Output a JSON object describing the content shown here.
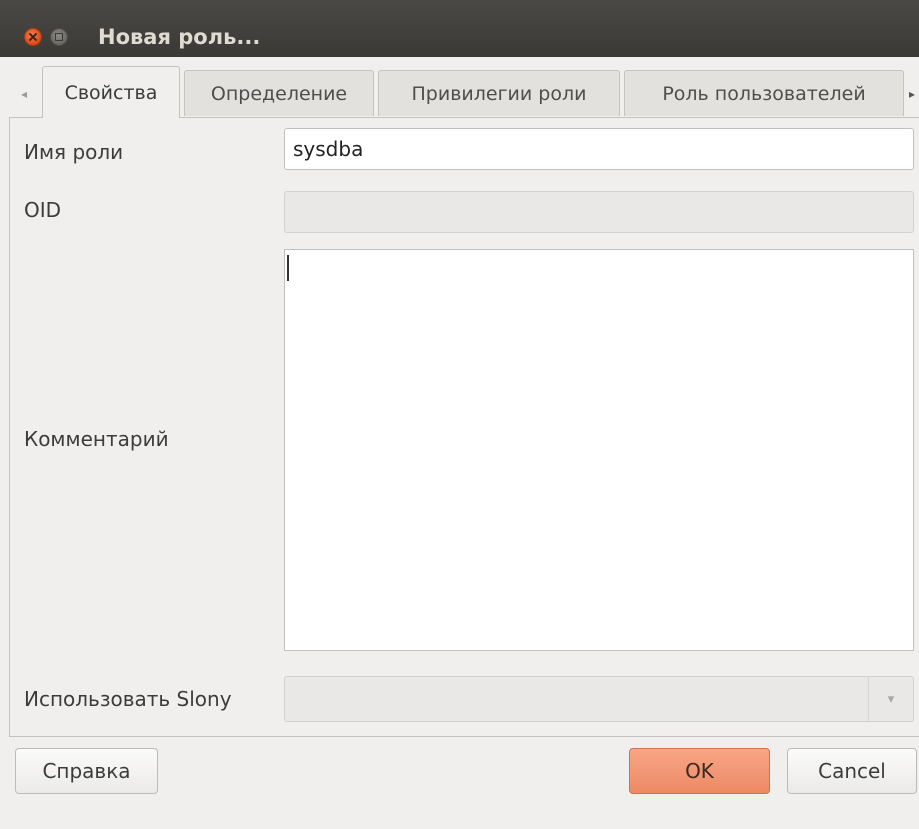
{
  "window": {
    "title": "Новая роль..."
  },
  "tabs": [
    {
      "label": "Свойства",
      "active": true
    },
    {
      "label": "Определение",
      "active": false
    },
    {
      "label": "Привилегии роли",
      "active": false
    },
    {
      "label": "Роль пользователей",
      "active": false
    }
  ],
  "form": {
    "role_name": {
      "label": "Имя роли",
      "value": "sysdba"
    },
    "oid": {
      "label": "OID",
      "value": ""
    },
    "comment": {
      "label": "Комментарий",
      "value": ""
    },
    "use_slony": {
      "label": "Использовать Slony",
      "value": ""
    }
  },
  "buttons": {
    "help": "Справка",
    "ok": "OK",
    "cancel": "Cancel"
  },
  "icons": {
    "tab_scroll_left": "◂",
    "tab_scroll_right": "▸",
    "combo_arrow": "▾"
  },
  "colors": {
    "titlebar": "#3c3b37",
    "close_button": "#dd4814",
    "primary_button": "#f09572",
    "window_background": "#f0efee"
  }
}
